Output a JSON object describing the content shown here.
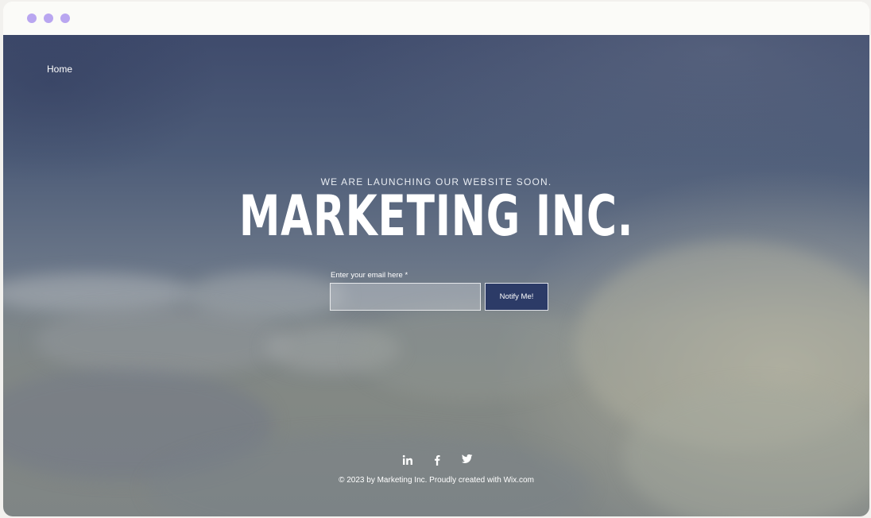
{
  "browser": {
    "window_controls": [
      "dot-icon",
      "dot-icon",
      "dot-icon"
    ]
  },
  "nav": {
    "home_label": "Home"
  },
  "hero": {
    "kicker": "WE ARE LAUNCHING OUR WEBSITE SOON.",
    "headline": "MARKETING INC."
  },
  "signup": {
    "email_label": "Enter your email here *",
    "email_value": "",
    "button_label": "Notify Me!"
  },
  "social": {
    "icons": [
      "linkedin-icon",
      "facebook-icon",
      "twitter-icon"
    ]
  },
  "footer": {
    "copyright": "© 2023 by Marketing Inc. Proudly created with Wix.com"
  },
  "colors": {
    "window_dot": "#b9a6f0",
    "button_bg": "#2c3b67",
    "text": "#ffffff"
  }
}
